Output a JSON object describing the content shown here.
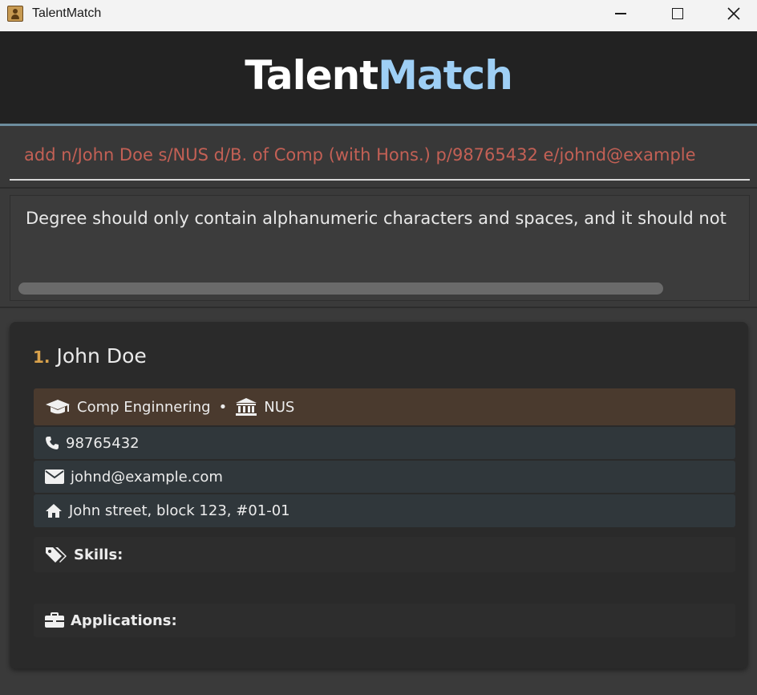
{
  "window": {
    "title": "TalentMatch"
  },
  "header": {
    "brand_part1": "Talent",
    "brand_part2": "Match"
  },
  "command": {
    "value": "add n/John Doe s/NUS d/B. of Comp (with Hons.) p/98765432 e/johnd@example"
  },
  "result": {
    "message": "Degree should only contain alphanumeric characters and spaces, and it should not"
  },
  "colors": {
    "accent_blue": "#9ecff5",
    "error_text": "#c36055",
    "index_color": "#d9a24c",
    "education_bg": "#4a3a2e",
    "contact_bg": "#30373b"
  },
  "persons": [
    {
      "index": "1.",
      "name": "John Doe",
      "degree": "Comp Enginnering",
      "separator": "•",
      "school": "NUS",
      "phone": "98765432",
      "email": "johnd@example.com",
      "address": "John street, block 123, #01-01",
      "skills_label": "Skills:",
      "applications_label": "Applications:",
      "icons": {
        "degree": "graduation-cap-icon",
        "school": "university-icon",
        "phone": "phone-icon",
        "email": "envelope-icon",
        "address": "home-icon",
        "skills": "tags-icon",
        "applications": "briefcase-icon"
      }
    }
  ]
}
